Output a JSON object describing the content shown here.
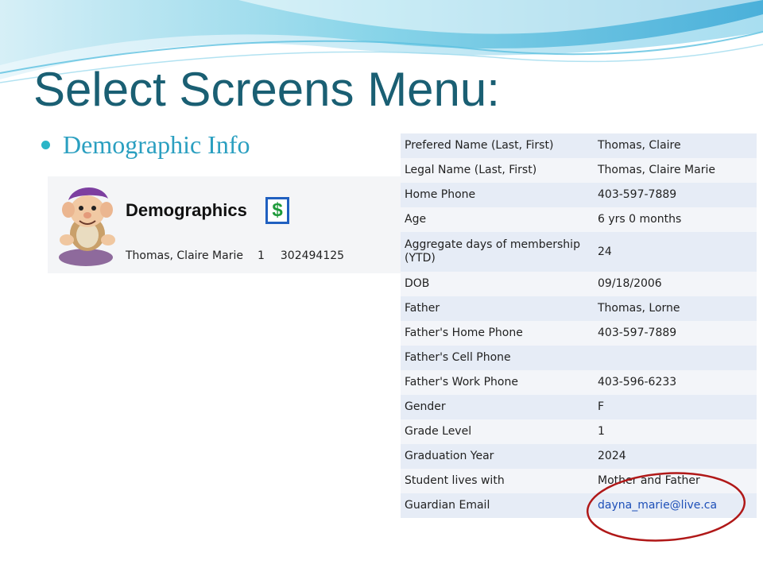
{
  "slide": {
    "title": "Select Screens Menu:",
    "bullet": "Demographic Info"
  },
  "demographics_card": {
    "heading": "Demographics",
    "icon": "dollar-icon",
    "student_name": "Thomas, Claire Marie",
    "grade": "1",
    "student_id": "302494125"
  },
  "info_rows": [
    {
      "label": "Prefered Name (Last, First)",
      "value": "Thomas, Claire"
    },
    {
      "label": "Legal Name (Last, First)",
      "value": "Thomas, Claire Marie"
    },
    {
      "label": "Home Phone",
      "value": "403-597-7889"
    },
    {
      "label": "Age",
      "value": "6 yrs 0 months"
    },
    {
      "label": "Aggregate days of membership (YTD)",
      "value": "24"
    },
    {
      "label": "DOB",
      "value": "09/18/2006"
    },
    {
      "label": "Father",
      "value": "Thomas, Lorne"
    },
    {
      "label": "Father's Home Phone",
      "value": "403-597-7889"
    },
    {
      "label": "Father's Cell Phone",
      "value": ""
    },
    {
      "label": "Father's Work Phone",
      "value": "403-596-6233"
    },
    {
      "label": "Gender",
      "value": "F"
    },
    {
      "label": "Grade Level",
      "value": "1"
    },
    {
      "label": "Graduation Year",
      "value": "2024"
    },
    {
      "label": "Student lives with",
      "value": "Mother and Father"
    },
    {
      "label": "Guardian Email",
      "value": "dayna_marie@live.ca"
    }
  ],
  "colors": {
    "title": "#1a5f73",
    "bullet_text": "#2a9fc0",
    "highlight_circle": "#b01818",
    "email_link": "#1d4fb8"
  }
}
